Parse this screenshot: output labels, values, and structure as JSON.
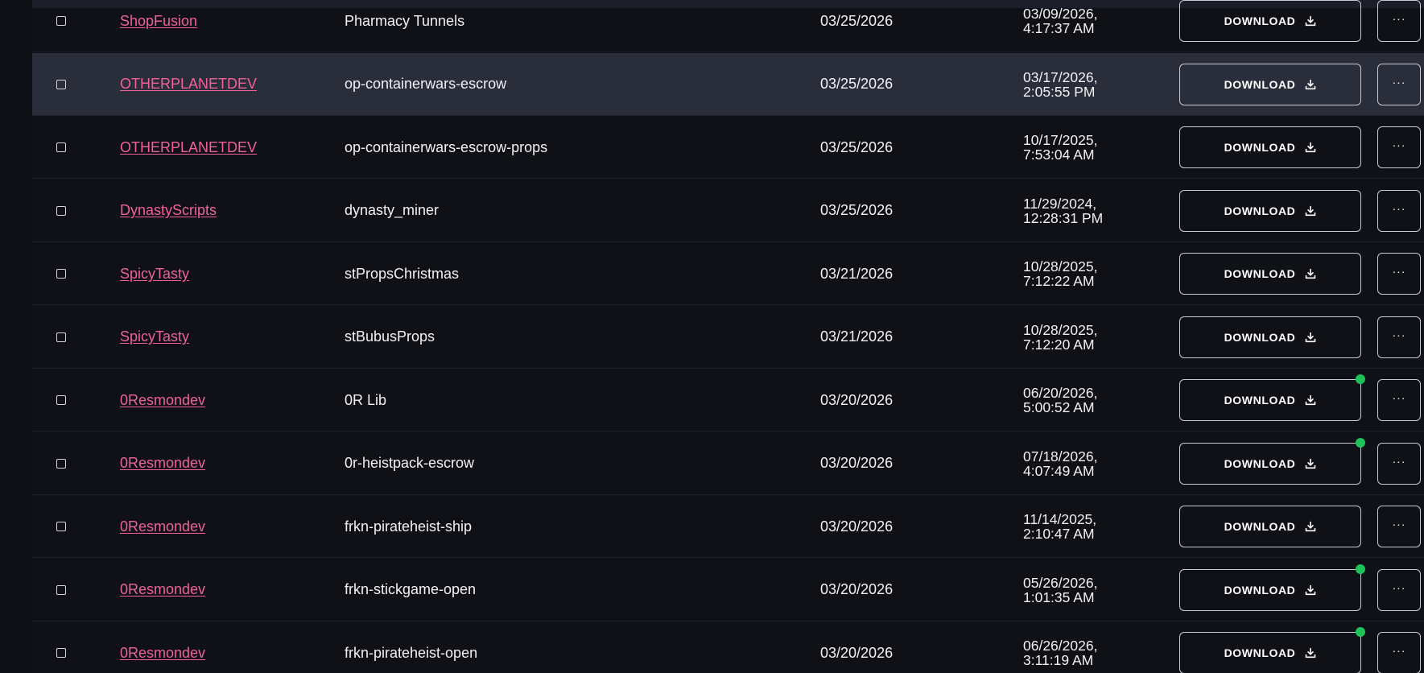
{
  "download_label": "DOWNLOAD",
  "more_label": "···",
  "colors": {
    "background": "#0f1117",
    "seller_link": "#f0619a",
    "new_indicator": "#1fc25a",
    "hover_row": "#2a2d3a"
  },
  "rows": [
    {
      "seller": "ShopFusion",
      "name": "Pharmacy Tunnels",
      "date": "03/25/2026",
      "updated_date": "03/09/2026,",
      "updated_time": "4:17:37 AM",
      "new": false,
      "hover": false
    },
    {
      "seller": "OTHERPLANETDEV",
      "name": "op-containerwars-escrow",
      "date": "03/25/2026",
      "updated_date": "03/17/2026,",
      "updated_time": "2:05:55 PM",
      "new": false,
      "hover": true
    },
    {
      "seller": "OTHERPLANETDEV",
      "name": "op-containerwars-escrow-props",
      "date": "03/25/2026",
      "updated_date": "10/17/2025,",
      "updated_time": "7:53:04 AM",
      "new": false,
      "hover": false
    },
    {
      "seller": "DynastyScripts",
      "name": "dynasty_miner",
      "date": "03/25/2026",
      "updated_date": "11/29/2024,",
      "updated_time": "12:28:31 PM",
      "new": false,
      "hover": false
    },
    {
      "seller": "SpicyTasty",
      "name": "stPropsChristmas",
      "date": "03/21/2026",
      "updated_date": "10/28/2025,",
      "updated_time": "7:12:22 AM",
      "new": false,
      "hover": false
    },
    {
      "seller": "SpicyTasty",
      "name": "stBubusProps",
      "date": "03/21/2026",
      "updated_date": "10/28/2025,",
      "updated_time": "7:12:20 AM",
      "new": false,
      "hover": false
    },
    {
      "seller": "0Resmondev",
      "name": "0R Lib",
      "date": "03/20/2026",
      "updated_date": "06/20/2026,",
      "updated_time": "5:00:52 AM",
      "new": true,
      "hover": false
    },
    {
      "seller": "0Resmondev",
      "name": "0r-heistpack-escrow",
      "date": "03/20/2026",
      "updated_date": "07/18/2026,",
      "updated_time": "4:07:49 AM",
      "new": true,
      "hover": false
    },
    {
      "seller": "0Resmondev",
      "name": "frkn-pirateheist-ship",
      "date": "03/20/2026",
      "updated_date": "11/14/2025,",
      "updated_time": "2:10:47 AM",
      "new": false,
      "hover": false
    },
    {
      "seller": "0Resmondev",
      "name": "frkn-stickgame-open",
      "date": "03/20/2026",
      "updated_date": "05/26/2026,",
      "updated_time": "1:01:35 AM",
      "new": true,
      "hover": false
    },
    {
      "seller": "0Resmondev",
      "name": "frkn-pirateheist-open",
      "date": "03/20/2026",
      "updated_date": "06/26/2026,",
      "updated_time": "3:11:19 AM",
      "new": true,
      "hover": false
    }
  ]
}
